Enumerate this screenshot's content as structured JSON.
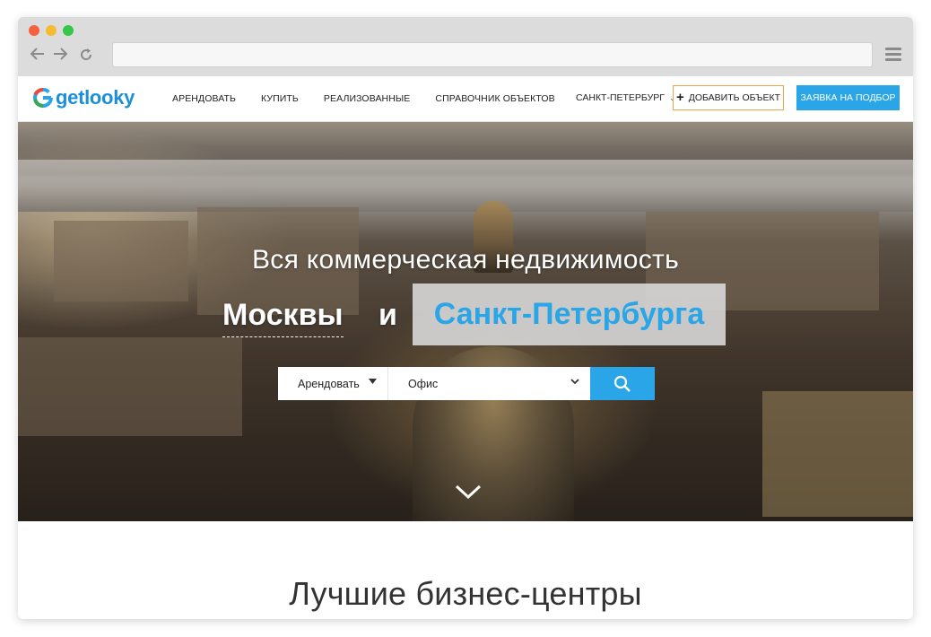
{
  "browser": {
    "back_icon": "arrow-left-icon",
    "forward_icon": "arrow-right-icon",
    "reload_icon": "reload-icon",
    "menu_icon": "hamburger-menu-icon",
    "address": ""
  },
  "header": {
    "logo_text": "getlooky",
    "nav": [
      {
        "label": "АРЕНДОВАТЬ"
      },
      {
        "label": "КУПИТЬ"
      },
      {
        "label": "РЕАЛИЗОВАННЫЕ"
      },
      {
        "label": "СПРАВОЧНИК ОБЪЕКТОВ"
      }
    ],
    "city": "САНКТ-ПЕТЕРБУРГ",
    "add_object": "ДОБАВИТЬ ОБЪЕКТ",
    "request": "ЗАЯВКА НА ПОДБОР"
  },
  "hero": {
    "title": "Вся коммерческая недвижимость",
    "city_a": "Москвы",
    "conjunction": "и",
    "city_b": "Санкт-Петербурга",
    "search": {
      "deal_type": "Арендовать",
      "object_type": "Офис"
    }
  },
  "section": {
    "title": "Лучшие бизнес-центры"
  },
  "colors": {
    "accent": "#2aa6e8",
    "add_border": "#f0a54b",
    "logo_blue": "#1d8fd8"
  }
}
